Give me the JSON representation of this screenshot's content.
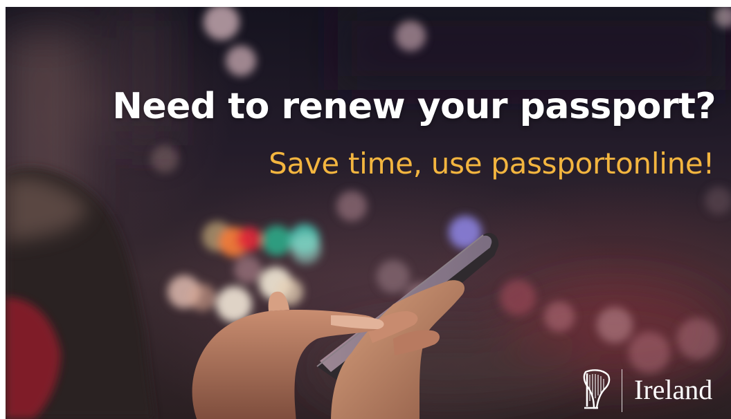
{
  "headline": "Need to renew your passport?",
  "subline": "Save time, use passportonline!",
  "logo": {
    "text": "Ireland",
    "icon": "harp-icon"
  },
  "colors": {
    "headline": "#ffffff",
    "subline": "#f3b53f",
    "background": "#241c2a"
  }
}
